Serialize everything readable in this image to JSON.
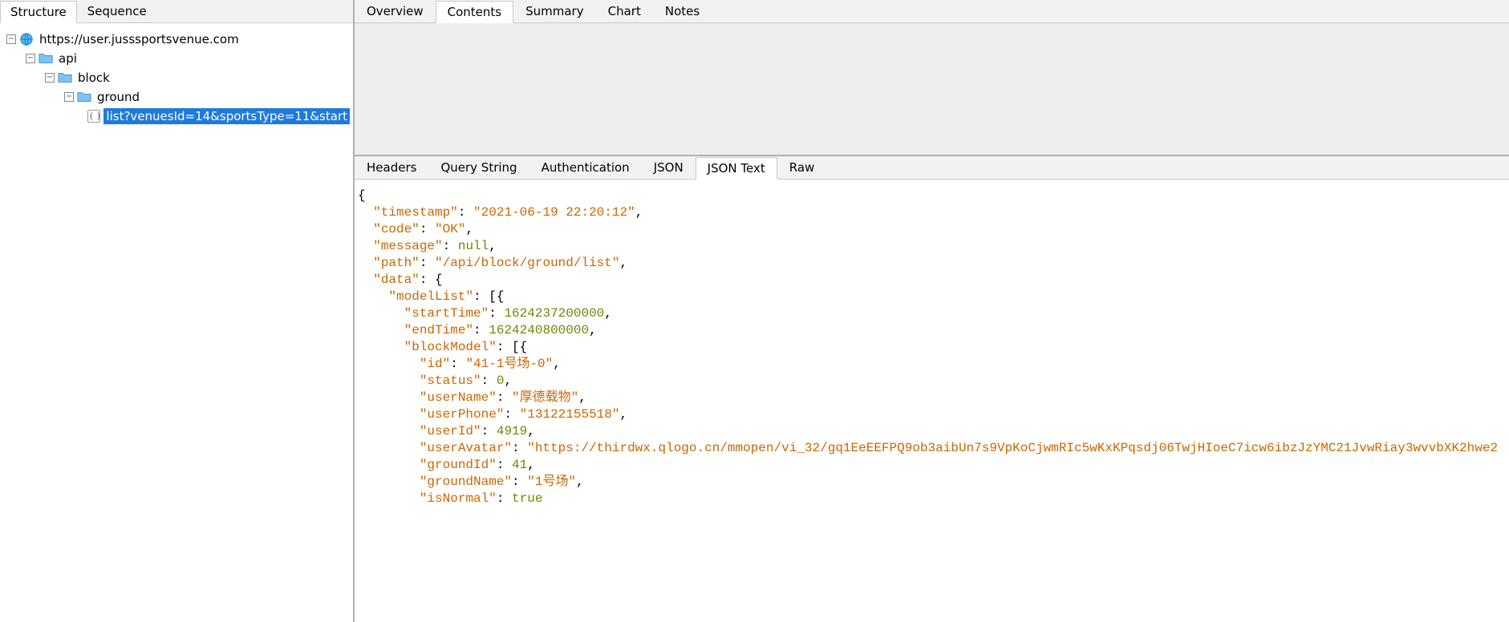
{
  "leftTabs": {
    "structure": "Structure",
    "sequence": "Sequence",
    "active": "structure"
  },
  "tree": {
    "host": "https://user.jusssportsvenue.com",
    "api": "api",
    "block": "block",
    "ground": "ground",
    "request": "list?venuesId=14&sportsType=11&start"
  },
  "rightTabs": {
    "overview": "Overview",
    "contents": "Contents",
    "summary": "Summary",
    "chart": "Chart",
    "notes": "Notes",
    "active": "contents"
  },
  "subTabs": {
    "headers": "Headers",
    "query": "Query String",
    "auth": "Authentication",
    "json": "JSON",
    "jsonText": "JSON Text",
    "raw": "Raw",
    "active": "jsonText"
  },
  "json": {
    "timestamp_key": "timestamp",
    "timestamp_val": "2021-06-19 22:20:12",
    "code_key": "code",
    "code_val": "OK",
    "message_key": "message",
    "message_val": "null",
    "path_key": "path",
    "path_val": "/api/block/ground/list",
    "data_key": "data",
    "modelList_key": "modelList",
    "startTime_key": "startTime",
    "startTime_val": "1624237200000",
    "endTime_key": "endTime",
    "endTime_val": "1624240800000",
    "blockModel_key": "blockModel",
    "id_key": "id",
    "id_val": "41-1号场-0",
    "status_key": "status",
    "status_val": "0",
    "userName_key": "userName",
    "userName_val": "厚德载物",
    "userPhone_key": "userPhone",
    "userPhone_val": "13122155518",
    "userId_key": "userId",
    "userId_val": "4919",
    "userAvatar_key": "userAvatar",
    "userAvatar_val": "https://thirdwx.qlogo.cn/mmopen/vi_32/gq1EeEEFPQ9ob3aibUn7s9VpKoCjwmRIc5wKxKPqsdj06TwjHIoeC7icw6ibzJzYMC21JvwRiay3wvvbXK2hwe2",
    "groundId_key": "groundId",
    "groundId_val": "41",
    "groundName_key": "groundName",
    "groundName_val": "1号场",
    "isNormal_key": "isNormal",
    "isNormal_val": "true"
  }
}
